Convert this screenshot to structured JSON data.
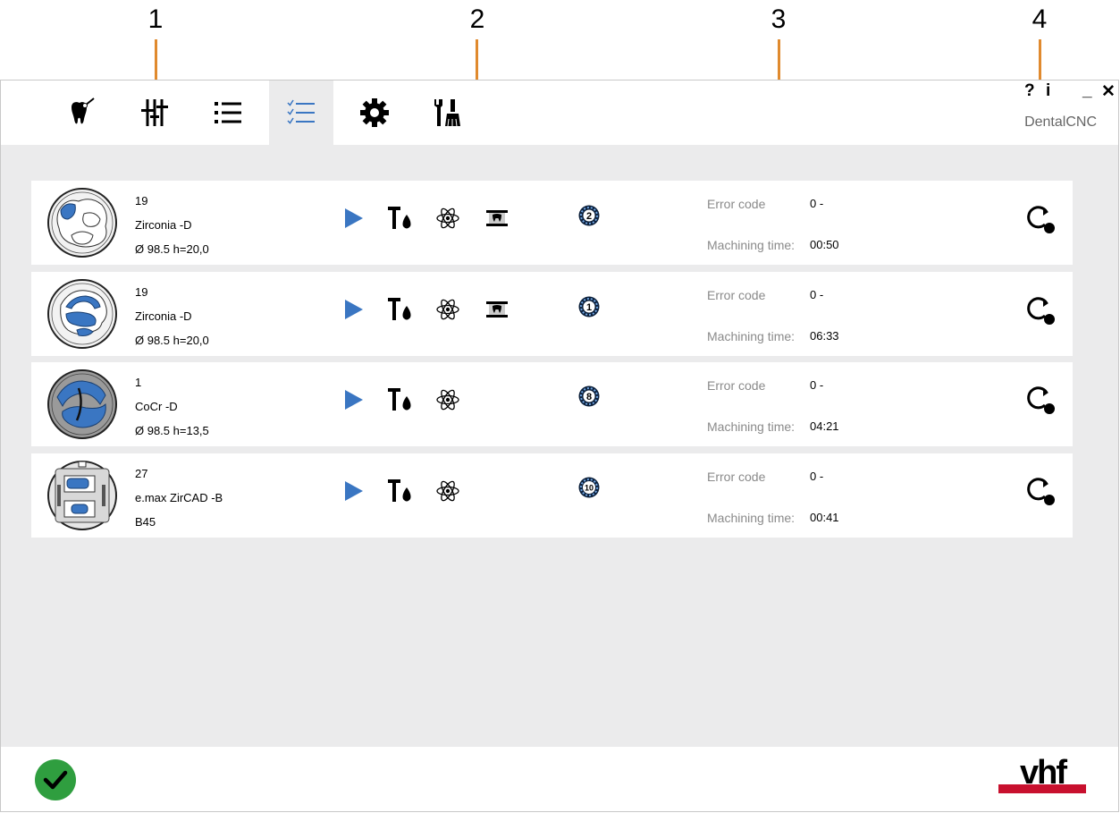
{
  "callouts": [
    "1",
    "2",
    "3",
    "4"
  ],
  "window": {
    "help": "?",
    "info": "i",
    "minimize": "_",
    "close": "✕",
    "app_name": "DentalCNC"
  },
  "toolbar": {
    "items": [
      {
        "icon": "tooth-tool-icon",
        "active": false
      },
      {
        "icon": "sliders-icon",
        "active": false
      },
      {
        "icon": "list-icon",
        "active": false
      },
      {
        "icon": "checklist-icon",
        "active": true
      },
      {
        "icon": "gear-icon",
        "active": false
      },
      {
        "icon": "tools-icon",
        "active": false
      }
    ]
  },
  "labels": {
    "error_code": "Error code",
    "machining_time": "Machining time:"
  },
  "jobs": [
    {
      "line1": "19",
      "line2": "Zirconia -D",
      "line3": "Ø 98.5  h=20,0",
      "has_tooth_icon": true,
      "slot": "2",
      "error_code": "0 -",
      "machining_time": "00:50"
    },
    {
      "line1": "19",
      "line2": "Zirconia -D",
      "line3": "Ø 98.5  h=20,0",
      "has_tooth_icon": true,
      "slot": "1",
      "error_code": "0 -",
      "machining_time": "06:33"
    },
    {
      "line1": "1",
      "line2": "CoCr -D",
      "line3": "Ø 98.5  h=13,5",
      "has_tooth_icon": false,
      "slot": "8",
      "error_code": "0 -",
      "machining_time": "04:21"
    },
    {
      "line1": "27",
      "line2": "e.max ZirCAD -B",
      "line3": "B45",
      "has_tooth_icon": false,
      "slot": "10",
      "error_code": "0 -",
      "machining_time": "00:41"
    }
  ],
  "footer": {
    "status_icon": "checkmark-icon",
    "logo_text": "vhf"
  },
  "colors": {
    "accent_blue": "#3a76c2",
    "callout_orange": "#e08a2e",
    "status_green": "#2f9e3f",
    "logo_red": "#c8102e"
  }
}
